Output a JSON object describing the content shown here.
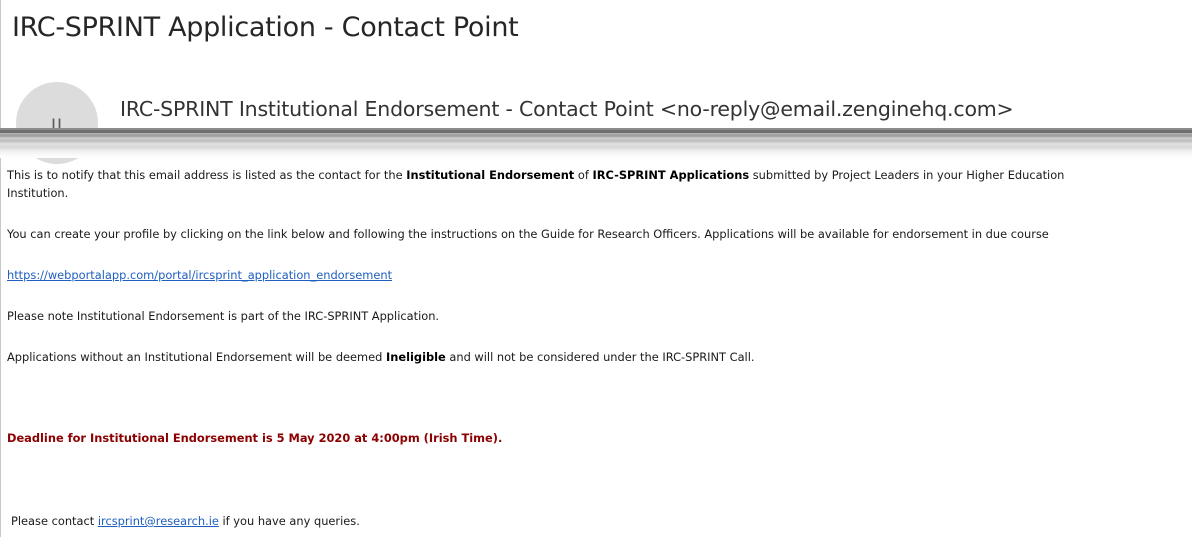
{
  "email": {
    "subject": "IRC-SPRINT Application - Contact Point",
    "sender": "IRC-SPRINT Institutional Endorsement - Contact Point <no-reply@email.zenginehq.com>",
    "avatar_initials": "II"
  },
  "body": {
    "p1": {
      "t1": "This is to notify that this email address is listed as the contact for the ",
      "b1": "Institutional Endorsement",
      "t2": " of ",
      "b2": "IRC-SPRINT Applications",
      "t3": " submitted by Project Leaders in your Higher Education",
      "line2": "Institution."
    },
    "p2": "You can create your profile by clicking on the link below and following the instructions on the Guide for Research Officers. Applications will be available for endorsement in due course",
    "link": "https://webportalapp.com/portal/ircsprint_application_endorsement",
    "p3": "Please note Institutional Endorsement is part of the IRC-SPRINT Application.",
    "p4": {
      "t1": "Applications without an Institutional Endorsement will be deemed ",
      "b1": "Ineligible",
      "t2": " and will not be considered under the IRC-SPRINT Call."
    },
    "deadline": "Deadline for Institutional Endorsement is 5 May 2020 at 4:00pm (Irish Time).",
    "contact": {
      "t1": "Please contact ",
      "email": "ircsprint@research.ie",
      "t2": " if you have any queries."
    }
  },
  "colors": {
    "deadline": "#8b0000",
    "link": "#1f5fbf",
    "avatar_bg": "#dcdcdc"
  }
}
